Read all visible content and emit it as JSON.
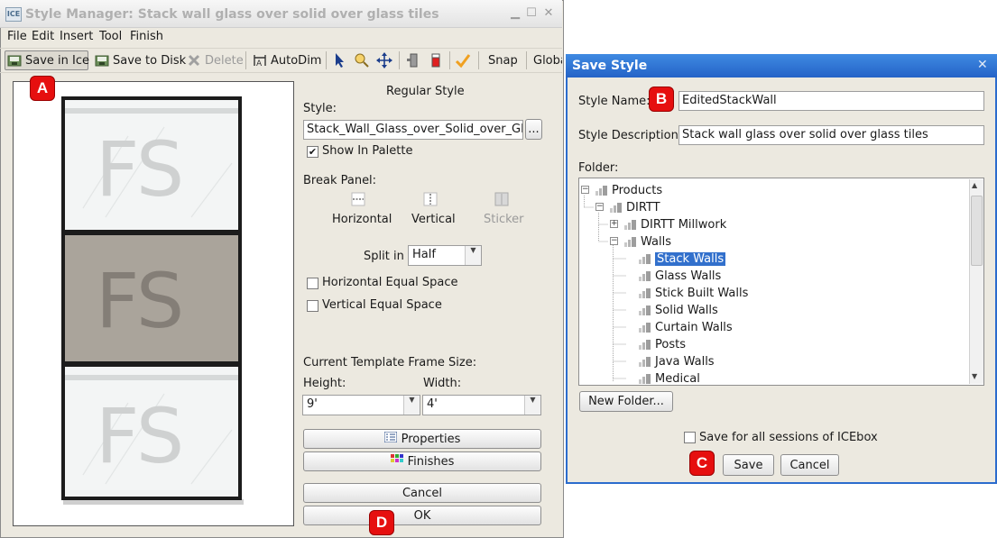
{
  "style_manager": {
    "title": "Style Manager: Stack wall glass over solid  over glass tiles",
    "app_icon_text": "ICE",
    "menu": [
      "File",
      "Edit",
      "Insert",
      "Tool",
      "Finish"
    ],
    "toolbar": {
      "save_in_ice": "Save in Ice",
      "save_to_disk": "Save to Disk",
      "delete": "Delete",
      "autodim": "AutoDim",
      "snap": "Snap",
      "global": "Globa"
    },
    "preview": {
      "panel_text": "FS"
    },
    "right": {
      "style_heading": "Regular Style",
      "style_label": "Style:",
      "style_value": "Stack_Wall_Glass_over_Solid_over_Glass_Tiles",
      "browse_label": "...",
      "show_in_palette": "Show In Palette",
      "show_in_palette_checked": true,
      "break_panel_label": "Break Panel:",
      "horizontal": "Horizontal",
      "vertical": "Vertical",
      "sticker": "Sticker",
      "split_in_label": "Split in",
      "split_in_value": "Half",
      "horizontal_equal_space": "Horizontal Equal Space",
      "vertical_equal_space": "Vertical Equal Space",
      "frame_size_label": "Current Template Frame Size:",
      "height_label": "Height:",
      "width_label": "Width:",
      "height_value": "9'",
      "width_value": "4'",
      "properties": "Properties",
      "finishes": "Finishes",
      "cancel": "Cancel",
      "ok": "OK"
    }
  },
  "save_style": {
    "title": "Save Style",
    "style_name_label": "Style Name:",
    "style_name_value": "EditedStackWall",
    "style_description_label": "Style Description:",
    "style_description_value": "Stack wall glass over solid  over glass tiles",
    "folder_label": "Folder:",
    "tree": {
      "products": "Products",
      "dirtt": "DIRTT",
      "dirtt_millwork": "DIRTT Millwork",
      "walls": "Walls",
      "children": [
        "Stack Walls",
        "Glass Walls",
        "Stick Built Walls",
        "Solid Walls",
        "Curtain Walls",
        "Posts",
        "Java Walls",
        "Medical"
      ],
      "selected": "Stack Walls"
    },
    "new_folder": "New Folder...",
    "save_all_sessions": "Save for all sessions of ICEbox",
    "save_all_sessions_checked": false,
    "save": "Save",
    "cancel": "Cancel"
  },
  "callouts": {
    "a": "A",
    "b": "B",
    "c": "C",
    "d": "D"
  },
  "colors": {
    "window_bg": "#ece9e0",
    "dialog_title": "#2563c7",
    "selection": "#3270cc",
    "callout": "#e60f0f",
    "solid_panel": "#a9a39a",
    "glass_panel": "#f3f5f5"
  }
}
